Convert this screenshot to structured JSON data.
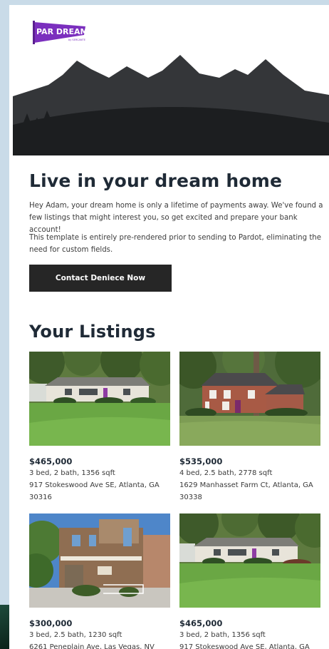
{
  "brand": {
    "logo_text": "PAR DREAMIN",
    "logo_subtext": "by SERCANTE",
    "logo_color": "#7b2fbe"
  },
  "hero": {
    "colors": {
      "sky": "#ffffff",
      "mountain": "#343639",
      "ground": "#1c1e20"
    }
  },
  "intro": {
    "title": "Live in your dream home",
    "paragraph1": "Hey Adam, your dream home is only a lifetime of payments away. We've found a few listings that might interest you, so get excited and prepare your bank account!",
    "paragraph2": "This template is entirely pre-rendered prior to sending to Pardot, eliminating the need for custom fields.",
    "cta_label": "Contact Deniece Now"
  },
  "listings_section": {
    "title": "Your Listings",
    "items": [
      {
        "price": "$465,000",
        "details": "3 bed, 2 bath, 1356 sqft",
        "address": "917 Stokeswood Ave SE, Atlanta, GA 30316"
      },
      {
        "price": "$535,000",
        "details": "4 bed, 2.5 bath, 2778 sqft",
        "address": "1629 Manhasset Farm Ct, Atlanta, GA 30338"
      },
      {
        "price": "$300,000",
        "details": "3 bed, 2.5 bath, 1230 sqft",
        "address": "6261 Peneplain Ave, Las Vegas, NV"
      },
      {
        "price": "$465,000",
        "details": "3 bed, 2 bath, 1356 sqft",
        "address": "917 Stokeswood Ave SE, Atlanta, GA"
      }
    ]
  }
}
